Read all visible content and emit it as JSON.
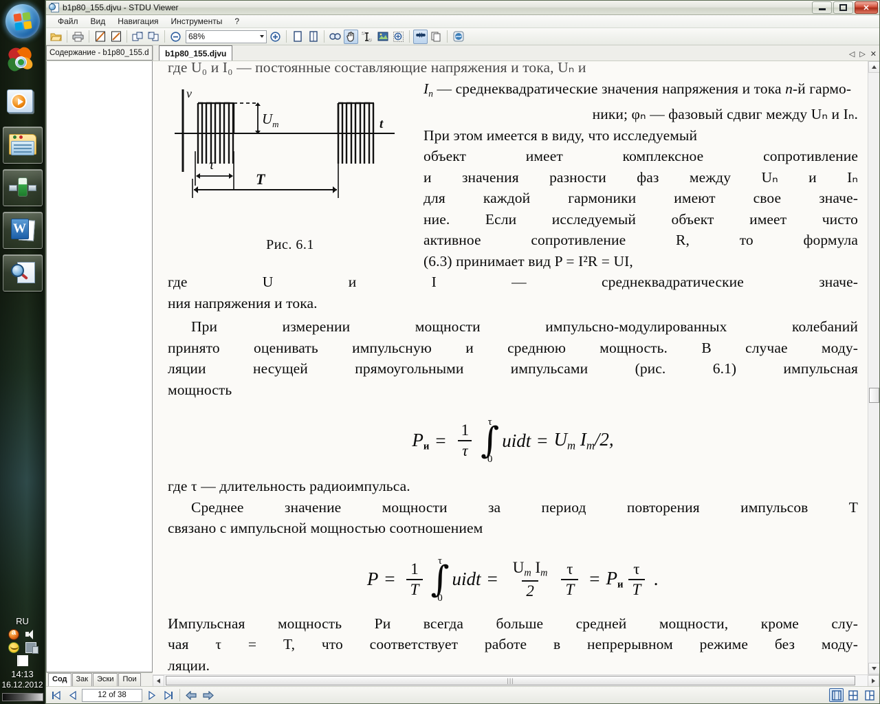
{
  "window": {
    "title": "b1p80_155.djvu - STDU Viewer",
    "icon": "document-magnifier-icon",
    "buttons": {
      "minimize": "minimize-icon",
      "maximize": "maximize-icon",
      "close": "✕"
    }
  },
  "menu": {
    "items": [
      "Файл",
      "Вид",
      "Навигация",
      "Инструменты",
      "?"
    ]
  },
  "toolbar": {
    "zoom_value": "68%",
    "icons": [
      "open-folder-icon",
      "print-icon",
      "page-fit-icon",
      "page-width-icon",
      "rotate-left-icon",
      "rotate-right-icon",
      "zoom-out-icon",
      "zoom-in-icon",
      "single-page-icon",
      "facing-pages-icon",
      "find-icon",
      "hand-tool-icon",
      "text-select-icon",
      "image-select-icon",
      "zoom-select-icon",
      "fullscreen-icon",
      "copy-icon",
      "settings-icon"
    ]
  },
  "sidebar": {
    "header": "Содержание - b1p80_155.d",
    "tabs": [
      {
        "label": "Сод",
        "name": "tab-contents",
        "selected": true
      },
      {
        "label": "Зак",
        "name": "tab-bookmarks",
        "selected": false
      },
      {
        "label": "Эски",
        "name": "tab-thumbnails",
        "selected": false
      },
      {
        "label": "Пои",
        "name": "tab-search",
        "selected": false
      }
    ]
  },
  "doctabs": {
    "active": "b1p80_155.djvu",
    "controls": [
      "◁",
      "▷",
      "✕"
    ]
  },
  "statusbar": {
    "first_page": "first-page-icon",
    "prev_page": "previous-page-icon",
    "page_indicator": "12 of 38",
    "next_page": "next-page-icon",
    "last_page": "last-page-icon",
    "back": "navigate-back-icon",
    "forward": "navigate-forward-icon",
    "view_modes": [
      "single-page-view",
      "continuous-view",
      "facing-view"
    ]
  },
  "tray": {
    "language": "RU",
    "icons": [
      "antivirus-icon",
      "volume-icon",
      "messenger-icon",
      "network-icon",
      "action-flag-icon"
    ],
    "time": "14:13",
    "date": "16.12.2012"
  },
  "taskbar": {
    "start": "windows-start-orb",
    "quick_launch": [
      "leaf-browser-icon",
      "media-player-icon"
    ],
    "buttons": [
      "explorer-window",
      "app-window",
      "word-window",
      "stdu-viewer-window"
    ]
  },
  "document": {
    "cut_top": "где U₀ и I₀ — постоянные составляющие напряжения и тока, Uₙ и",
    "line2_a": "I",
    "line2_b": " — среднеквадратические значения напряжения и тока ",
    "line2_c": "n",
    "line2_d": "-й гармо-",
    "line3": "ники; φₙ — фазовый сдвиг между Uₙ и Iₙ.",
    "wrap_lines": [
      "При этом имеется в виду, что исследуемый",
      "объект имеет комплексное сопротивление",
      "и значения разности фаз между Uₙ и Iₙ",
      "для каждой гармоники имеют свое значе-",
      "ние. Если исследуемый объект имеет чисто",
      "активное сопротивление R, то формула",
      "(6.3) принимает вид P = I²R = UI,",
      "где U и I — среднеквадратические значе-",
      "ния напряжения и тока."
    ],
    "figure": {
      "caption": "Рис. 6.1",
      "axis_y": "v",
      "axis_x": "t",
      "label_amp": "Um",
      "label_tau": "τ",
      "label_period": "T"
    },
    "para2": [
      "При измерении мощности импульсно-модулированных колебаний",
      "принято оценивать импульсную и среднюю мощность. В случае моду-",
      "ляции несущей прямоугольными импульсами (рис. 6.1) импульсная",
      "мощность"
    ],
    "formula1": {
      "lhs": "P",
      "lhs_sub": "и",
      "eq1": "=",
      "frac_num": "1",
      "frac_den": "τ",
      "int_upper": "τ",
      "int_lower": "0",
      "integrand": "uidt",
      "eq2": "=",
      "rhs": "Um Im/2,"
    },
    "para3": [
      "где τ — длительность радиоимпульса.",
      "Среднее значение мощности за период повторения импульсов T",
      "связано с импульсной мощностью соотношением"
    ],
    "formula2": {
      "lhs": "P",
      "eq1": "=",
      "frac1_num": "1",
      "frac1_den": "T",
      "int_upper": "τ",
      "int_lower": "0",
      "integrand": "uidt",
      "eq2": "=",
      "frac2_num": "Um Im",
      "frac2_den": "2",
      "frac3_num": "τ",
      "frac3_den": "T",
      "eq3": "=",
      "rhs_p": "P",
      "rhs_sub": "и",
      "frac4_num": "τ",
      "frac4_den": "T",
      "period": "."
    },
    "para4": [
      "Импульсная мощность Pи всегда больше средней мощности, кроме слу-",
      "чая τ = T, что соответствует работе в непрерывном режиме без моду-",
      "ляции."
    ]
  },
  "colors": {
    "accent": "#2f5f9e",
    "close_button": "#b8341c",
    "page_bg": "#fbfaf7",
    "chrome": "#f0f0ec"
  }
}
